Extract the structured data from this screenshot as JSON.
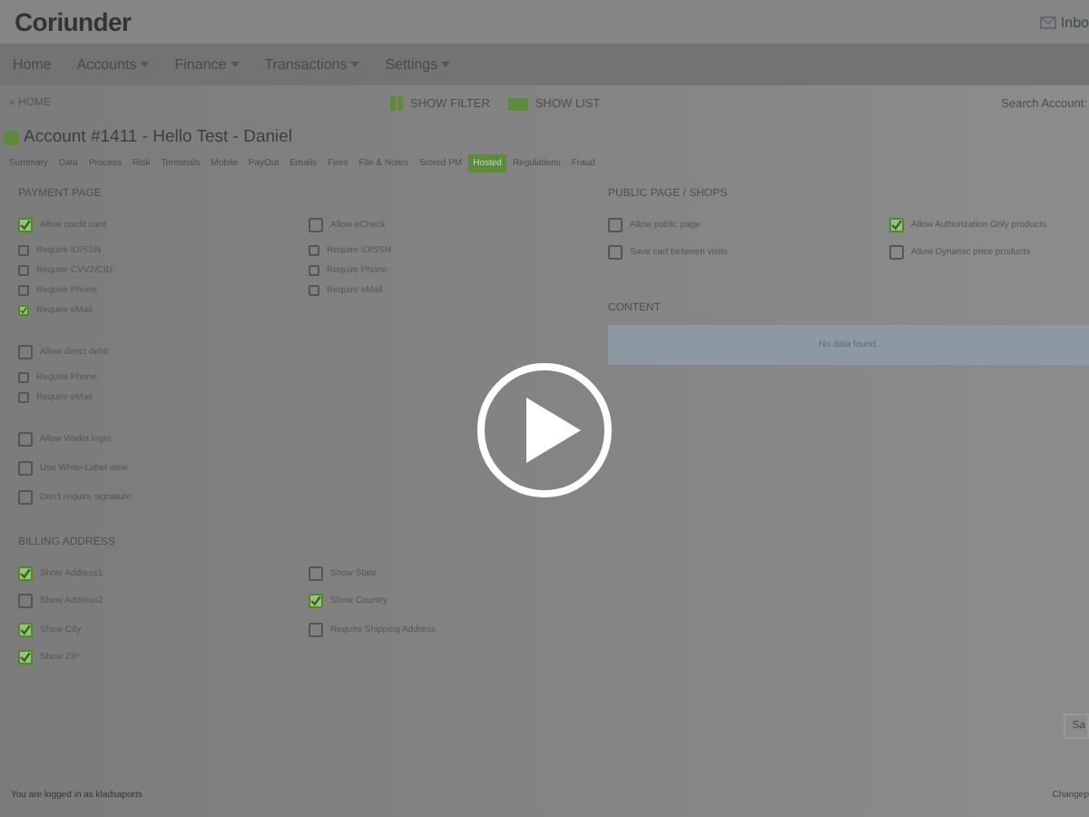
{
  "header": {
    "logo": "Coriunder",
    "inbox": "Inbo"
  },
  "nav": [
    {
      "label": "Home",
      "dropdown": false
    },
    {
      "label": "Accounts",
      "dropdown": true
    },
    {
      "label": "Finance",
      "dropdown": true
    },
    {
      "label": "Transactions",
      "dropdown": true
    },
    {
      "label": "Settings",
      "dropdown": true
    }
  ],
  "toolbar": {
    "back": "« HOME",
    "show_filter": "SHOW FILTER",
    "show_list": "SHOW LIST",
    "search_label": "Search Account:"
  },
  "title": "Account #1411 - Hello Test - Daniel",
  "tabs": [
    {
      "label": "Summary",
      "selected": false
    },
    {
      "label": "Data",
      "selected": false
    },
    {
      "label": "Process",
      "selected": false
    },
    {
      "label": "Risk",
      "selected": false
    },
    {
      "label": "Terminals",
      "selected": false
    },
    {
      "label": "Mobile",
      "selected": false
    },
    {
      "label": "PayOut",
      "selected": false
    },
    {
      "label": "Emails",
      "selected": false
    },
    {
      "label": "Fees",
      "selected": false
    },
    {
      "label": "File & Notes",
      "selected": false
    },
    {
      "label": "Stored PM",
      "selected": false
    },
    {
      "label": "Hosted",
      "selected": true
    },
    {
      "label": "Regulations",
      "selected": false
    },
    {
      "label": "Fraud",
      "selected": false
    }
  ],
  "payment_page": {
    "heading": "PAYMENT PAGE",
    "left": [
      [
        {
          "kind": "main",
          "label": "Allow credit card",
          "checked": true
        },
        {
          "kind": "sub",
          "label": "Require ID/SSN",
          "checked": false
        },
        {
          "kind": "sub",
          "label": "Require CVV2/CID",
          "checked": false
        },
        {
          "kind": "sub",
          "label": "Require Phone",
          "checked": false
        },
        {
          "kind": "sub",
          "label": "Require eMail",
          "checked": true
        }
      ],
      [
        {
          "kind": "main",
          "label": "Allow direct debit",
          "checked": false
        },
        {
          "kind": "sub",
          "label": "Require Phone",
          "checked": false
        },
        {
          "kind": "sub",
          "label": "Require eMail",
          "checked": false
        }
      ],
      [
        {
          "kind": "main",
          "label": "Allow Wallet login",
          "checked": false
        },
        {
          "kind": "main",
          "label": "Use White-Label view",
          "checked": false
        },
        {
          "kind": "main",
          "label": "Don't require signature",
          "checked": false
        }
      ]
    ],
    "right": [
      [
        {
          "kind": "main",
          "label": "Allow eCheck",
          "checked": false
        },
        {
          "kind": "sub",
          "label": "Require ID/SSN",
          "checked": false
        },
        {
          "kind": "sub",
          "label": "Require Phone",
          "checked": false
        },
        {
          "kind": "sub",
          "label": "Require eMail",
          "checked": false
        }
      ]
    ]
  },
  "billing_address": {
    "heading": "BILLING ADDRESS",
    "left": [
      {
        "kind": "main",
        "label": "Show Address1",
        "checked": true
      },
      {
        "kind": "main",
        "label": "Show Address2",
        "checked": false
      },
      {
        "kind": "main",
        "label": "Show City",
        "checked": true
      },
      {
        "kind": "main",
        "label": "Show ZIP",
        "checked": true
      }
    ],
    "right": [
      {
        "kind": "main",
        "label": "Show State",
        "checked": false
      },
      {
        "kind": "main",
        "label": "Show Country",
        "checked": true
      },
      {
        "kind": "main",
        "label": "Require Shipping Address",
        "checked": false
      }
    ]
  },
  "public_page": {
    "heading": "PUBLIC PAGE / SHOPS",
    "left": [
      {
        "kind": "main",
        "label": "Allow public page",
        "checked": false
      },
      {
        "kind": "main",
        "label": "Save cart between visits",
        "checked": false
      }
    ],
    "right": [
      {
        "kind": "main",
        "label": "Allow Authorization Only products",
        "checked": true
      },
      {
        "kind": "main",
        "label": "Allow Dynamic price products",
        "checked": false
      }
    ]
  },
  "content": {
    "heading": "CONTENT",
    "empty_message": "No data found."
  },
  "save_button": "Sa",
  "footer": {
    "logged_in": "You are logged in as kladsaports",
    "change": "Changep"
  }
}
